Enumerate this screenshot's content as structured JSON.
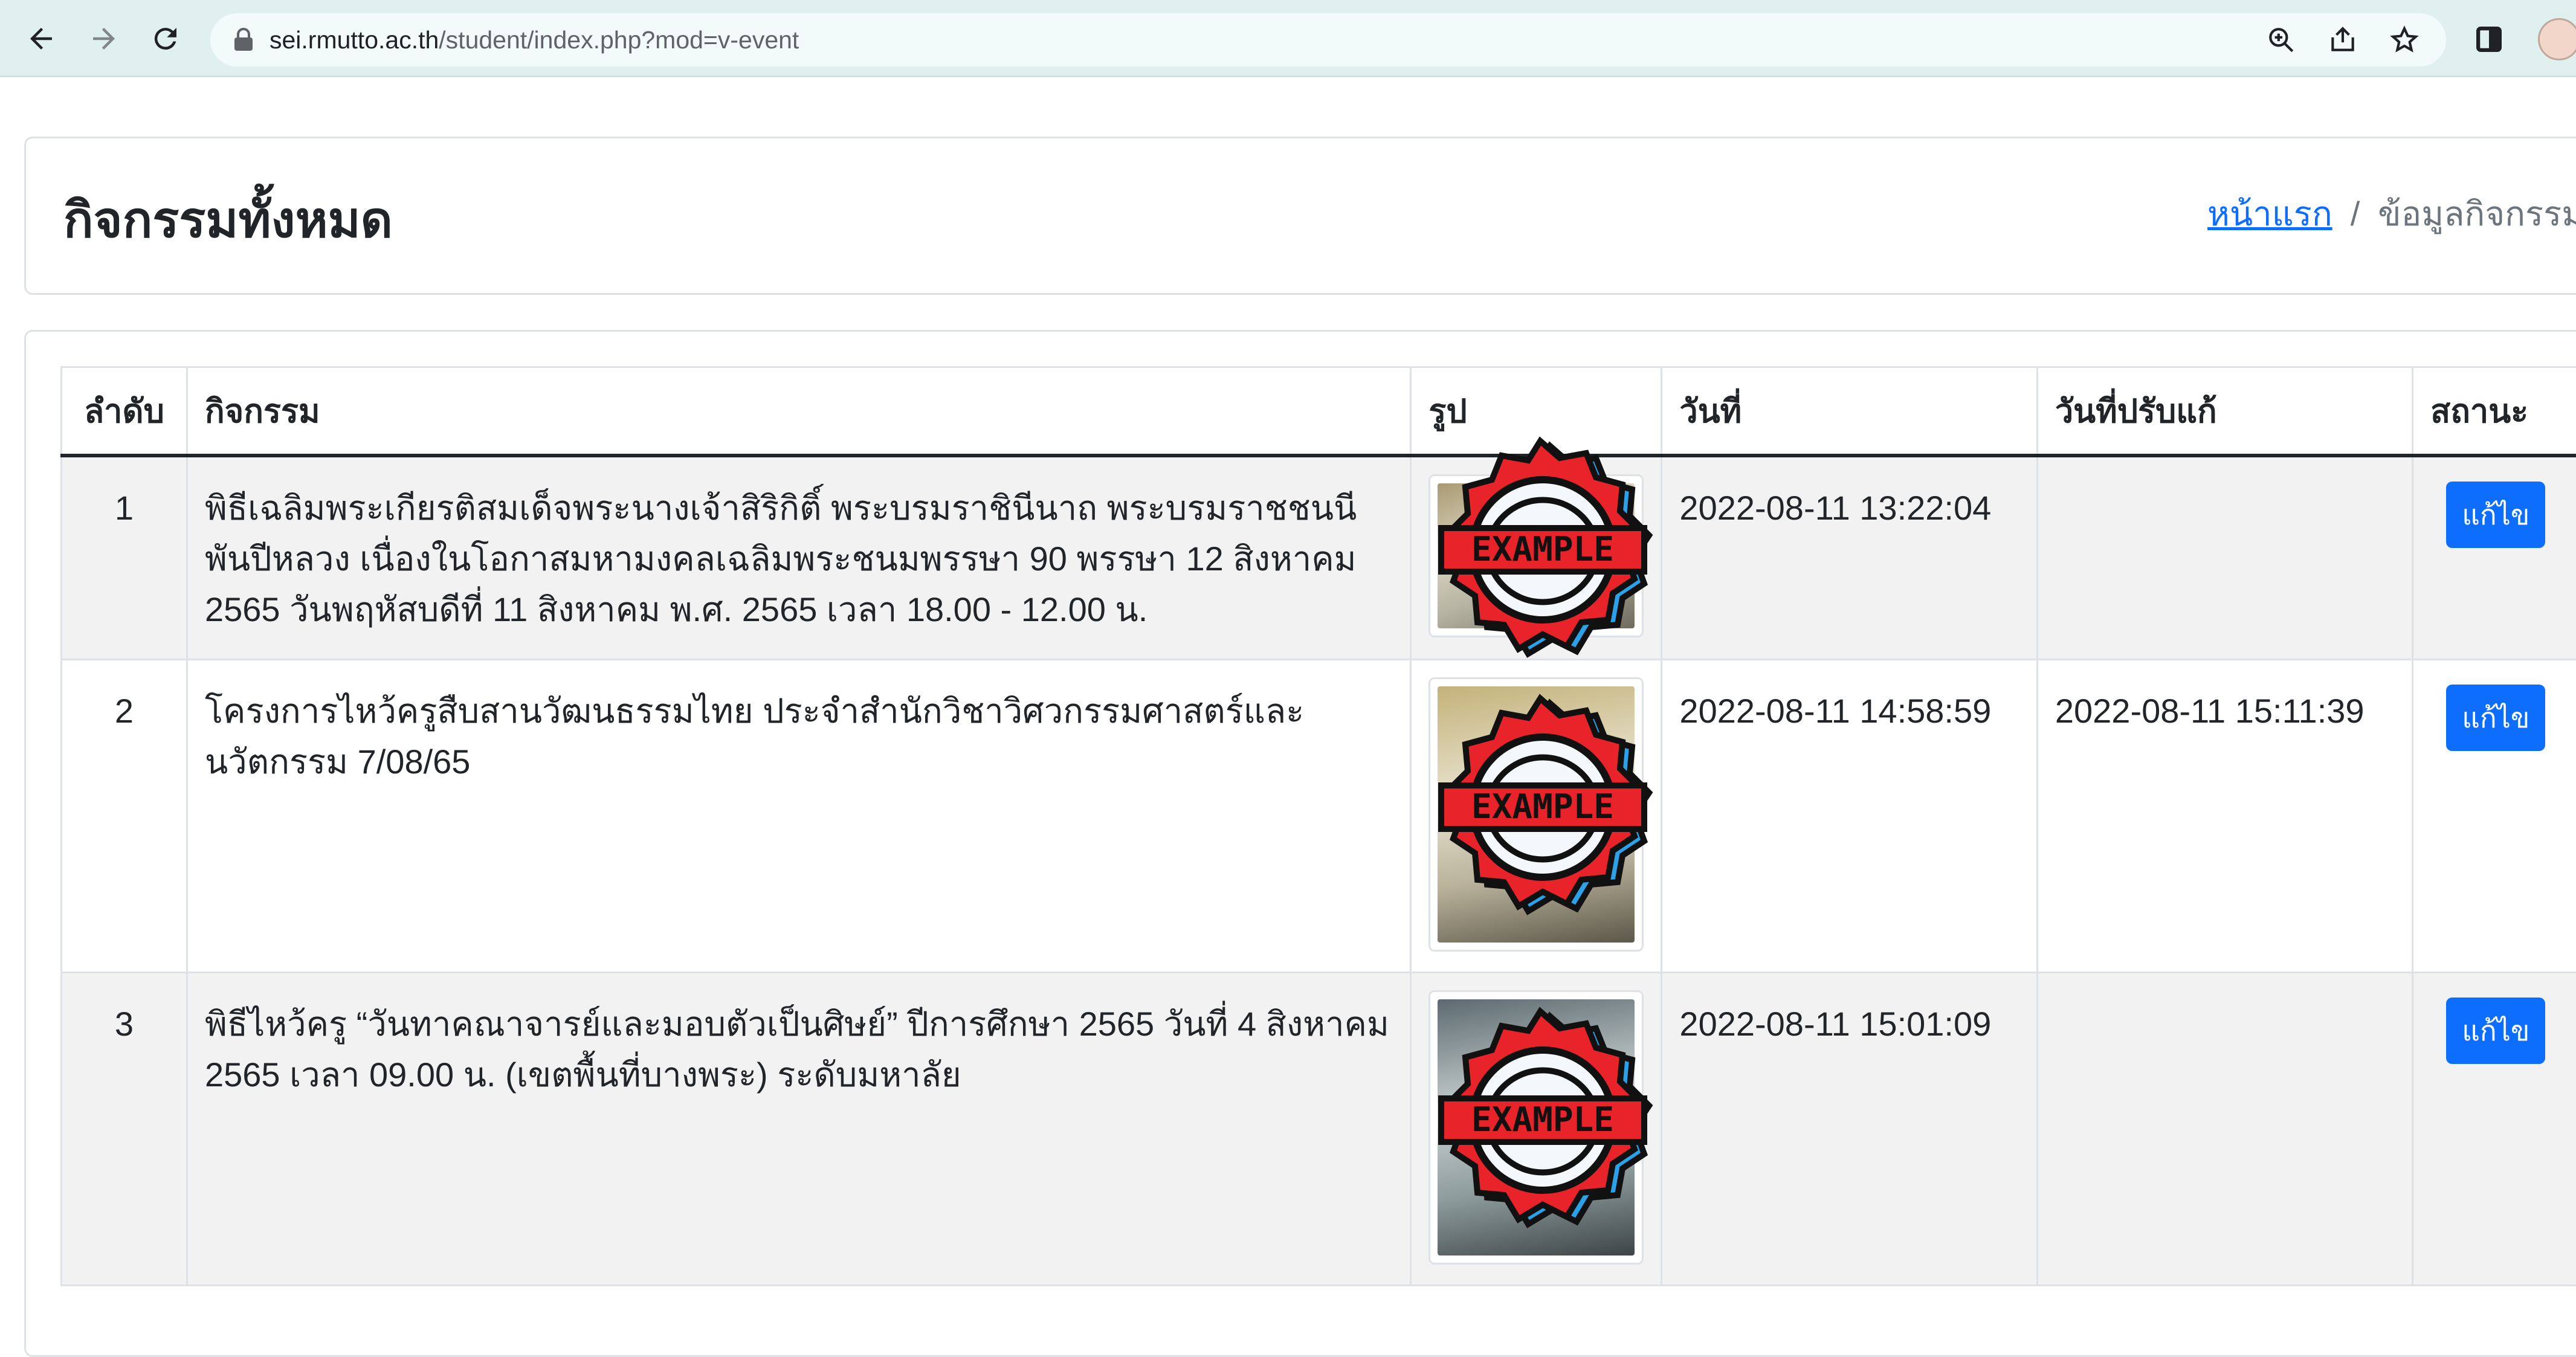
{
  "browser": {
    "url_host": "sei.rmutto.ac.th",
    "url_path": "/student/index.php?mod=v-event",
    "icons": [
      "back-arrow-icon",
      "forward-arrow-icon",
      "reload-icon",
      "lock-icon",
      "zoom-icon",
      "share-icon",
      "star-icon",
      "side-panel-icon"
    ]
  },
  "header": {
    "title": "กิจกรรมทั้งหมด",
    "breadcrumb_home": "หน้าแรก",
    "breadcrumb_separator": "/",
    "breadcrumb_current": "ข้อมูลกิจกรรม"
  },
  "table": {
    "columns": [
      "ลำดับ",
      "กิจกรรม",
      "รูป",
      "วันที่",
      "วันที่ปรับแก้",
      "สถานะ"
    ],
    "rows": [
      {
        "no": "1",
        "event": "พิธีเฉลิมพระเกียรติสมเด็จพระนางเจ้าสิริกิติ์ พระบรมราชินีนาถ พระบรมราชชนนีพันปีหลวง เนื่องในโอกาสมหามงคลเฉลิมพระชนมพรรษา 90 พรรษา 12 สิงหาคม 2565 วันพฤหัสบดีที่ 11 สิงหาคม พ.ศ. 2565 เวลา 18.00 - 12.00 น.",
        "date": "2022-08-11 13:22:04",
        "updated": "",
        "action": "แก้ไข",
        "stamp_text": "EXAMPLE"
      },
      {
        "no": "2",
        "event": "โครงการไหว้ครูสืบสานวัฒนธรรมไทย ประจำสำนักวิชาวิศวกรรมศาสตร์และนวัตกรรม 7/08/65",
        "date": "2022-08-11 14:58:59",
        "updated": "2022-08-11 15:11:39",
        "action": "แก้ไข",
        "stamp_text": "EXAMPLE"
      },
      {
        "no": "3",
        "event": "พิธีไหว้ครู “วันทาคณาจารย์และมอบตัวเป็นศิษย์” ปีการศึกษา 2565 วันที่ 4 สิงหาคม 2565 เวลา 09.00 น. (เขตพื้นที่บางพระ) ระดับมหาลัย",
        "date": "2022-08-11 15:01:09",
        "updated": "",
        "action": "แก้ไข",
        "stamp_text": "EXAMPLE"
      }
    ]
  },
  "colors": {
    "accent": "#0d6efd",
    "stamp_red": "#e8242a",
    "stamp_blue": "#2aa1e8",
    "stripe": "#f2f2f2",
    "chrome": "#dff0ef"
  }
}
